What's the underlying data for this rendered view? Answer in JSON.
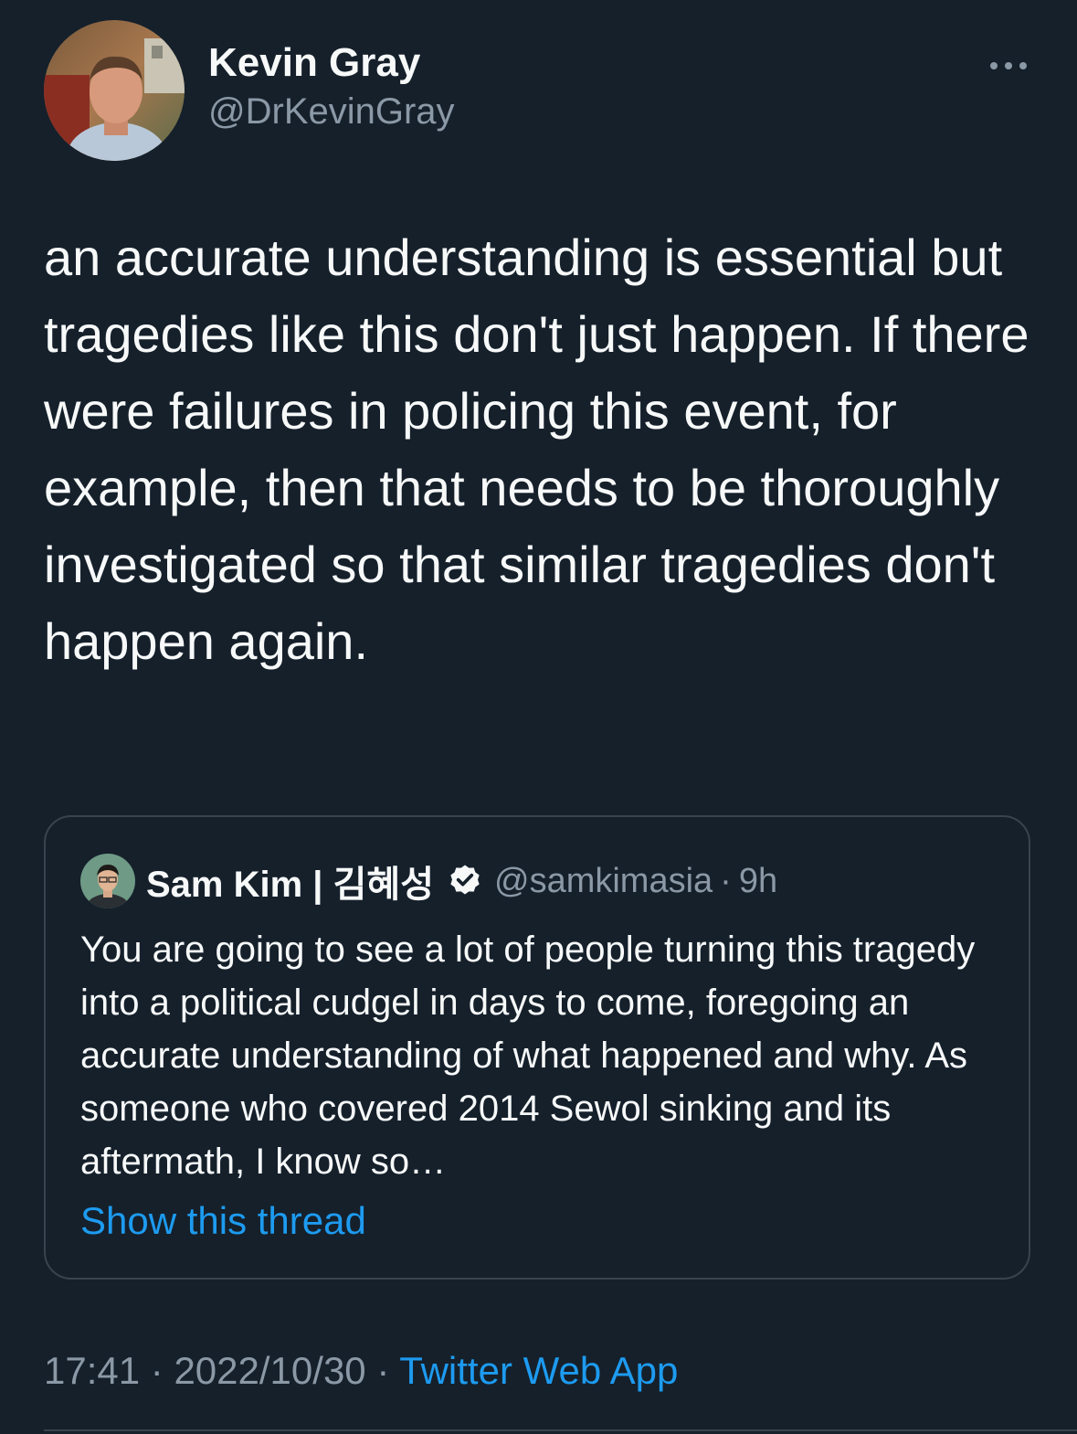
{
  "colors": {
    "background": "#15202b",
    "primary_text": "#f7f9f9",
    "secondary_text": "#8b98a5",
    "link": "#1d9bf0",
    "border": "#38444d"
  },
  "tweet": {
    "author_name": "Kevin Gray",
    "author_handle": "@DrKevinGray",
    "more_icon": "more-horizontal-icon",
    "text": "an accurate understanding is essential but tragedies like this don't just happen. If there were failures in policing this event, for example, then that needs to be thoroughly investigated so that similar tragedies don't happen again.",
    "time": "17:41",
    "separator": "·",
    "date": "2022/10/30",
    "source": "Twitter Web App"
  },
  "quote": {
    "author_name": "Sam Kim | 김혜성",
    "verified_icon": "verified-badge-icon",
    "author_handle": "@samkimasia",
    "separator": "·",
    "time_ago": "9h",
    "text": "You are going to see a lot of people turning this tragedy into a political cudgel in days to come, foregoing an accurate understanding of what happened and why. As someone who covered 2014 Sewol sinking and its aftermath, I know so…",
    "show_thread": "Show this thread"
  }
}
